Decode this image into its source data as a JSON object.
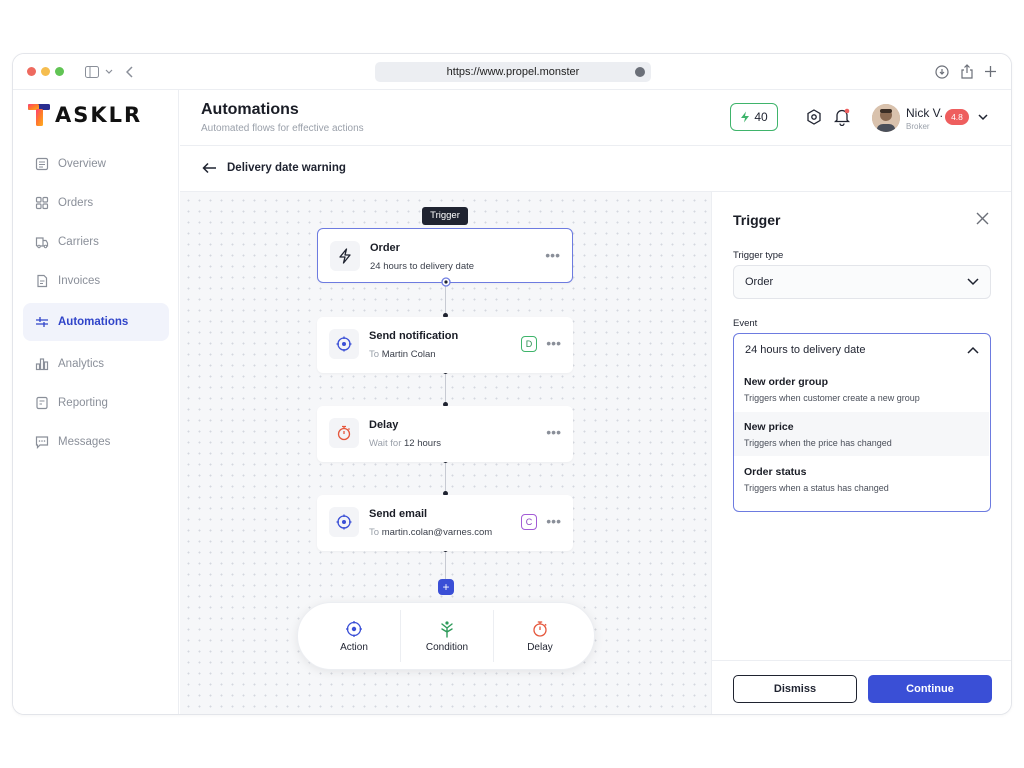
{
  "browser": {
    "url": "https://www.propel.monster"
  },
  "sidebar": {
    "logo": "ASKLR",
    "items": [
      {
        "label": "Overview",
        "icon": "overview-icon"
      },
      {
        "label": "Orders",
        "icon": "orders-icon"
      },
      {
        "label": "Carriers",
        "icon": "carriers-icon"
      },
      {
        "label": "Invoices",
        "icon": "invoices-icon"
      },
      {
        "label": "Automations",
        "icon": "automations-icon",
        "active": true
      },
      {
        "label": "Analytics",
        "icon": "analytics-icon"
      },
      {
        "label": "Reporting",
        "icon": "reporting-icon"
      },
      {
        "label": "Messages",
        "icon": "messages-icon"
      }
    ]
  },
  "header": {
    "title": "Automations",
    "subtitle": "Automated flows for effective actions",
    "credits": "40",
    "user": {
      "name": "Nick V.",
      "role": "Broker",
      "rating": "4.8"
    }
  },
  "subheader": {
    "title": "Delivery date warning"
  },
  "flow": {
    "trigger_tag": "Trigger",
    "nodes": [
      {
        "title": "Order",
        "sub_prefix": "",
        "sub_value": "24 hours to delivery date",
        "icon": "lightning-icon"
      },
      {
        "title": "Send notification",
        "sub_prefix": "To",
        "sub_value": "Martin Colan",
        "badge": "D",
        "icon": "target-icon"
      },
      {
        "title": "Delay",
        "sub_prefix": "Wait for",
        "sub_value": "12 hours",
        "icon": "stopwatch-icon"
      },
      {
        "title": "Send email",
        "sub_prefix": "To",
        "sub_value": "martin.colan@varnes.com",
        "badge": "C",
        "icon": "target-icon"
      }
    ],
    "add_label": "+",
    "palette": [
      {
        "label": "Action",
        "icon": "action-icon"
      },
      {
        "label": "Condition",
        "icon": "condition-icon"
      },
      {
        "label": "Delay",
        "icon": "delay-icon"
      }
    ]
  },
  "panel": {
    "title": "Trigger",
    "trigger_type_label": "Trigger type",
    "trigger_type_value": "Order",
    "event_label": "Event",
    "event_value": "24 hours to delivery date",
    "options": [
      {
        "title": "New order group",
        "desc": "Triggers when customer create a new group"
      },
      {
        "title": "New price",
        "desc": "Triggers when the price has changed"
      },
      {
        "title": "Order status",
        "desc": "Triggers when a status has changed"
      }
    ],
    "dismiss_label": "Dismiss",
    "continue_label": "Continue"
  },
  "colors": {
    "accent": "#3a4fd6",
    "selected_border": "#6d7be0",
    "credits_border": "#3fb46b",
    "rating_badge": "#ee5e5e",
    "badge_d": "#3fb46b",
    "badge_c": "#a35bd6"
  }
}
